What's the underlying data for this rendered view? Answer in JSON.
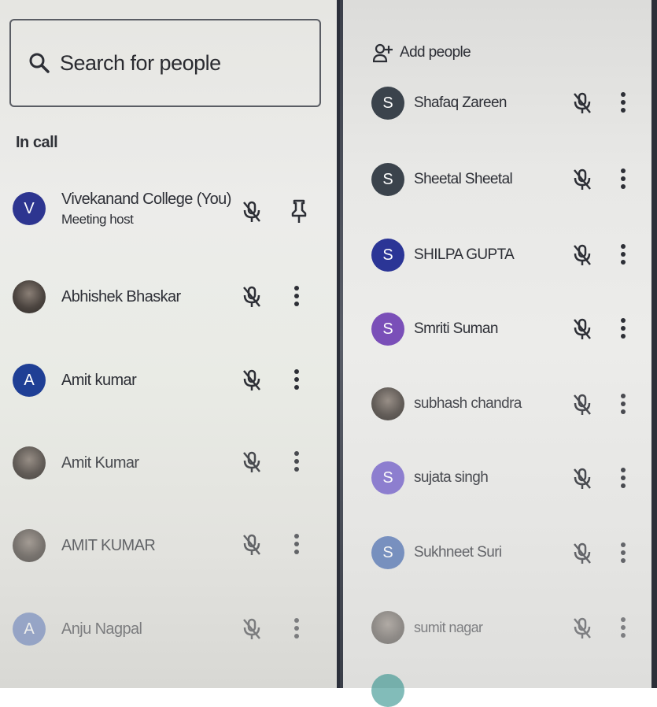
{
  "left_panel": {
    "search": {
      "placeholder": "Search for people",
      "icon": "search-icon"
    },
    "section_title": "In call",
    "people": [
      {
        "name": "Vivekanand College (You)",
        "subtitle": "Meeting host",
        "avatar_letter": "V",
        "avatar_color": "#2d3590",
        "action": "pin-icon"
      },
      {
        "name": "Abhishek Bhaskar",
        "avatar_letter": "",
        "avatar_type": "photo",
        "action": "more-options-icon"
      },
      {
        "name": "Amit kumar",
        "avatar_letter": "A",
        "avatar_color": "#1f3f95",
        "action": "more-options-icon"
      },
      {
        "name": "Amit Kumar",
        "avatar_letter": "",
        "avatar_type": "photo",
        "action": "more-options-icon"
      },
      {
        "name": "AMIT KUMAR",
        "avatar_letter": "",
        "avatar_type": "photo",
        "action": "more-options-icon"
      },
      {
        "name": "Anju Nagpal",
        "avatar_letter": "A",
        "avatar_color": "#5d78b7",
        "action": "more-options-icon"
      }
    ]
  },
  "right_panel": {
    "add_people_label": "Add people",
    "people": [
      {
        "name": "Shafaq Zareen",
        "avatar_letter": "S",
        "avatar_color": "#3b434c"
      },
      {
        "name": "Sheetal Sheetal",
        "avatar_letter": "S",
        "avatar_color": "#3b434c"
      },
      {
        "name": "SHILPA GUPTA",
        "avatar_letter": "S",
        "avatar_color": "#2b3596"
      },
      {
        "name": "Smriti Suman",
        "avatar_letter": "S",
        "avatar_color": "#7a4fb8"
      },
      {
        "name": "subhash chandra",
        "avatar_letter": "",
        "avatar_type": "photo"
      },
      {
        "name": "sujata singh",
        "avatar_letter": "S",
        "avatar_color": "#7e6ccc"
      },
      {
        "name": "Sukhneet Suri",
        "avatar_letter": "S",
        "avatar_color": "#4a6db0"
      },
      {
        "name": "sumit nagar",
        "avatar_letter": "",
        "avatar_type": "photo"
      }
    ]
  },
  "colors": {
    "mic_off_icon": "#2d2f36",
    "text": "#2d2f36"
  }
}
